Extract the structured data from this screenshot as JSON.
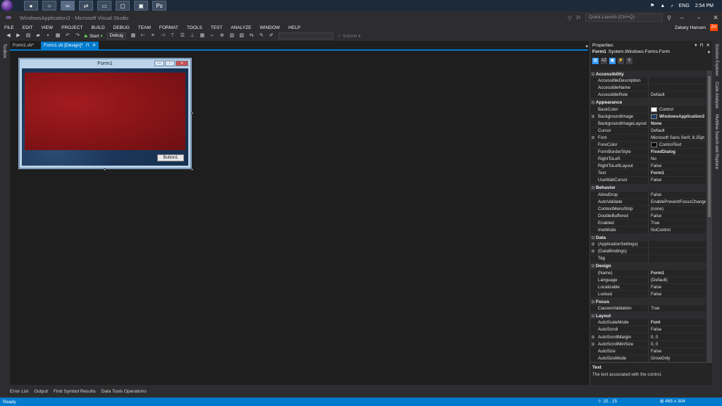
{
  "taskbar": {
    "apps": [
      "",
      "",
      "",
      "",
      "",
      "",
      "",
      ""
    ],
    "tray": {
      "lang": "ENG",
      "time": "2:54 PM"
    }
  },
  "window": {
    "title": "WindowsApplication3 - Microsoft Visual Studio",
    "quick_launch_placeholder": "Quick Launch (Ctrl+Q)"
  },
  "menu": [
    "FILE",
    "EDIT",
    "VIEW",
    "PROJECT",
    "BUILD",
    "DEBUG",
    "TEAM",
    "FORMAT",
    "TOOLS",
    "TEST",
    "ANALYZE",
    "WINDOW",
    "HELP"
  ],
  "user": {
    "name": "Zakary Hansen",
    "initials": "ZH"
  },
  "toolbar": {
    "start_label": "Start",
    "config": "Debug",
    "submit_label": "Submit"
  },
  "left_strip": {
    "toolbox": "Toolbox"
  },
  "tabs": [
    {
      "label": "Form1.vb*"
    },
    {
      "label": "Form1.vb [Design]*"
    }
  ],
  "designer": {
    "form_title": "Form1",
    "button_label": "Button1"
  },
  "properties": {
    "title": "Properties",
    "selected_name": "Form1",
    "selected_type": "System.Windows.Forms.Form",
    "categories": [
      {
        "name": "Accessibility",
        "rows": [
          {
            "name": "AccessibleDescription",
            "value": ""
          },
          {
            "name": "AccessibleName",
            "value": ""
          },
          {
            "name": "AccessibleRole",
            "value": "Default"
          }
        ]
      },
      {
        "name": "Appearance",
        "rows": [
          {
            "name": "BackColor",
            "value": "Control",
            "swatch": "#ffffff"
          },
          {
            "name": "BackgroundImage",
            "value": "WindowsApplication3",
            "swatch": "#1d3a5f",
            "expandable": true,
            "bold": true
          },
          {
            "name": "BackgroundImageLayout",
            "value": "None",
            "bold": true
          },
          {
            "name": "Cursor",
            "value": "Default"
          },
          {
            "name": "Font",
            "value": "Microsoft Sans Serif, 8.25pt",
            "expandable": true
          },
          {
            "name": "ForeColor",
            "value": "ControlText",
            "swatch": "#000000"
          },
          {
            "name": "FormBorderStyle",
            "value": "FixedDialog",
            "bold": true
          },
          {
            "name": "RightToLeft",
            "value": "No"
          },
          {
            "name": "RightToLeftLayout",
            "value": "False"
          },
          {
            "name": "Text",
            "value": "Form1",
            "bold": true
          },
          {
            "name": "UseWaitCursor",
            "value": "False"
          }
        ]
      },
      {
        "name": "Behavior",
        "rows": [
          {
            "name": "AllowDrop",
            "value": "False"
          },
          {
            "name": "AutoValidate",
            "value": "EnablePreventFocusChange"
          },
          {
            "name": "ContextMenuStrip",
            "value": "(none)"
          },
          {
            "name": "DoubleBuffered",
            "value": "False"
          },
          {
            "name": "Enabled",
            "value": "True"
          },
          {
            "name": "ImeMode",
            "value": "NoControl"
          }
        ]
      },
      {
        "name": "Data",
        "rows": [
          {
            "name": "(ApplicationSettings)",
            "value": "",
            "expandable": true
          },
          {
            "name": "(DataBindings)",
            "value": "",
            "expandable": true
          },
          {
            "name": "Tag",
            "value": ""
          }
        ]
      },
      {
        "name": "Design",
        "rows": [
          {
            "name": "(Name)",
            "value": "Form1",
            "bold": true
          },
          {
            "name": "Language",
            "value": "(Default)"
          },
          {
            "name": "Localizable",
            "value": "False"
          },
          {
            "name": "Locked",
            "value": "False"
          }
        ]
      },
      {
        "name": "Focus",
        "rows": [
          {
            "name": "CausesValidation",
            "value": "True"
          }
        ]
      },
      {
        "name": "Layout",
        "rows": [
          {
            "name": "AutoScaleMode",
            "value": "Font",
            "bold": true
          },
          {
            "name": "AutoScroll",
            "value": "False"
          },
          {
            "name": "AutoScrollMargin",
            "value": "0, 0",
            "expandable": true
          },
          {
            "name": "AutoScrollMinSize",
            "value": "0, 0",
            "expandable": true
          },
          {
            "name": "AutoSize",
            "value": "False"
          },
          {
            "name": "AutoSizeMode",
            "value": "GrowOnly"
          }
        ]
      }
    ],
    "description_title": "Text",
    "description_text": "The text associated with the control."
  },
  "right_strip": [
    "Solution Explorer",
    "Code Analysis",
    "Multiline Search and Replace"
  ],
  "bottom_tabs": [
    "Error List",
    "Output",
    "Find Symbol Results",
    "Data Tools Operations"
  ],
  "status": {
    "text": "Ready",
    "position": "15 , 15",
    "size": "465 x 304"
  }
}
